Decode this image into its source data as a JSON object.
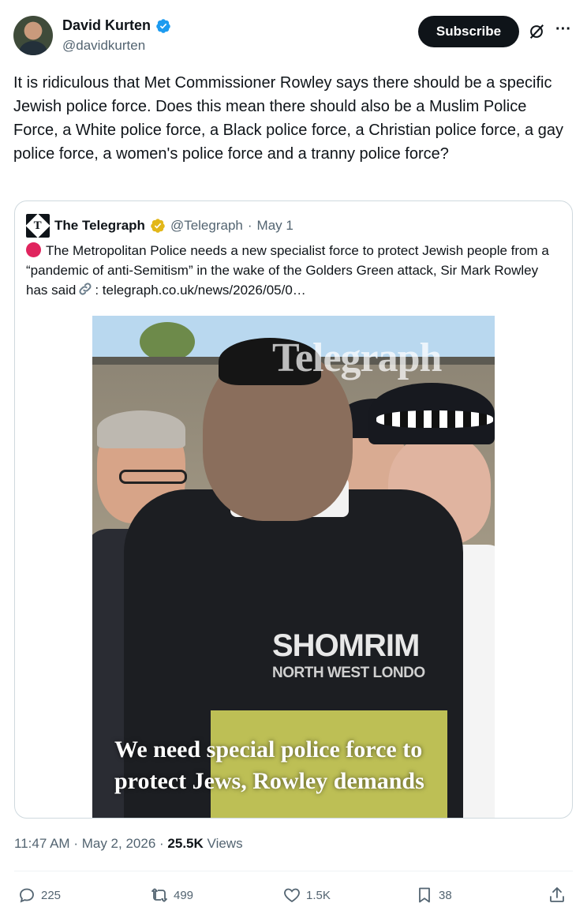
{
  "author": {
    "display_name": "David Kurten",
    "handle": "@davidkurten",
    "verified": true
  },
  "header": {
    "subscribe_label": "Subscribe",
    "more_label": "···"
  },
  "tweet": {
    "text": "It is ridiculous that Met Commissioner Rowley says there should be a specific Jewish police force. Does this mean there should also be a Muslim Police Force, a White police force, a Black police force, a Christian police force, a gay police force, a women's police force and a tranny police force?"
  },
  "quote": {
    "name": "The Telegraph",
    "handle": "@Telegraph",
    "separator": "·",
    "date": "May 1",
    "text_before_link": "The Metropolitan Police needs a new specialist force to protect Jewish people from a “pandemic of anti-Semitism” in the wake of the Golders Green attack, Sir Mark Rowley has said",
    "text_after_link": ": telegraph.co.uk/news/2026/05/0…",
    "image": {
      "watermark": "Telegraph",
      "vest_text": "SHOMRIM",
      "vest_subtext": "NORTH WEST LONDO",
      "headline": "We need special police force to protect Jews, Rowley demands"
    }
  },
  "meta": {
    "time": "11:47 AM",
    "sep1": "·",
    "date": "May 2, 2026",
    "sep2": "·",
    "views_count": "25.5K",
    "views_label": "Views"
  },
  "actions": {
    "replies": "225",
    "reposts": "499",
    "likes": "1.5K",
    "bookmarks": "38"
  },
  "colors": {
    "subscribe_bg": "#0f1419",
    "verified_blue": "#1d9bf0",
    "gold_badge": "#e2b719",
    "secondary_text": "#536471"
  }
}
